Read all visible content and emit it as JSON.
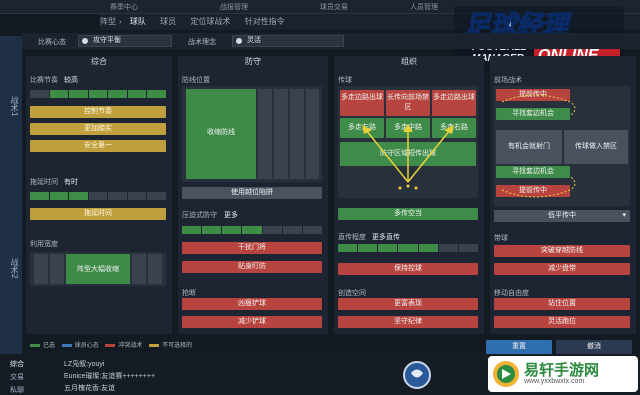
{
  "topbar": {
    "items": [
      "赛季中心",
      "战报管理",
      "球员交易",
      "人员管理"
    ]
  },
  "tabs": [
    {
      "label": "阵型",
      "active": false
    },
    {
      "label": "球队",
      "active": true
    },
    {
      "label": "球员",
      "active": false
    },
    {
      "label": "定位球战术",
      "active": false
    },
    {
      "label": "针对性指令",
      "active": false
    }
  ],
  "left_rail": {
    "tab1": "战术1",
    "tab2": "战术2"
  },
  "selectors": {
    "mentality_label": "比赛心态",
    "mentality_value": "攻守平衡",
    "philosophy_label": "战术理念",
    "philosophy_value": "灵活"
  },
  "panels": {
    "general": {
      "title": "综合",
      "tempo_label": "比赛节奏",
      "tempo_value": "较高",
      "btn_control": "控制节奏",
      "btn_more_aggr": "更加踏实",
      "btn_safe": "安全第一",
      "timewaste_label": "拖延时间",
      "timewaste_value": "有时",
      "btn_timewaste": "拖延时间",
      "width_label": "利用宽度",
      "formation_btn": "阵型大幅收缩"
    },
    "defense": {
      "title": "防守",
      "line_label": "防线位置",
      "line_btn": "收缩防线",
      "offside_btn": "使用越位陷阱",
      "press_label": "压迫式防守",
      "press_value": "更多",
      "btn_keeper": "干扰门将",
      "btn_tight": "贴身盯防",
      "tackle_label": "抢断",
      "btn_hard": "凶狠铲球",
      "btn_less": "减少铲球"
    },
    "build": {
      "title": "组织",
      "pass_label": "传球",
      "btn_flank": "多走边路出球",
      "btn_long": "长传向前场禁区",
      "btn_right_flank": "多走边路出球",
      "btn_left": "多走左路",
      "btn_mid": "多走中路",
      "btn_right": "多走右路",
      "btn_play_out": "防守区域短传出球",
      "btn_more_space": "多传空当",
      "directness_label": "直传程度",
      "directness_value": "更多直传",
      "btn_keep": "保持控球",
      "creative_label": "创造空间",
      "btn_express": "更富表现",
      "btn_discipline": "坚守纪律"
    },
    "attack": {
      "title": "前场战术",
      "btn_early_cross": "提前传中",
      "btn_overlap_l": "寻找套边机会",
      "btn_shoot": "有机会就射门",
      "btn_into_box": "传球做入禁区",
      "btn_overlap_r": "寻找套边机会",
      "btn_early_cross2": "提前传中",
      "cross_select": "低平传中",
      "dribble_label": "带球",
      "btn_dribble": "突破穿越防线",
      "btn_less_dribble": "减少盘带",
      "roam_label": "移动自由度",
      "btn_hold": "站住位置",
      "btn_roam": "灵活跑位"
    }
  },
  "legend": [
    {
      "label": "已选",
      "color": "#3d8d47"
    },
    {
      "label": "球员心态",
      "color": "#3a78b8"
    },
    {
      "label": "冲突战术",
      "color": "#b8443f"
    },
    {
      "label": "不可选择的",
      "color": "#bfa03c"
    }
  ],
  "footer": {
    "reset": "重置",
    "undo": "撤消"
  },
  "chat": {
    "tabs": [
      "综合",
      "交易",
      "私聊"
    ],
    "lines": [
      "LZ凫叙:youyi",
      "Eunice璀璨:友谊赛++++++++",
      "五月槐花香:友谊"
    ]
  },
  "logo": {
    "cn": "足球经理",
    "en1": "FOOTBALL",
    "en2": "MANAGER",
    "en3": "ONLINE"
  },
  "watermark": {
    "title": "易轩手游网",
    "url": "www.yxxbwxtx.com"
  }
}
